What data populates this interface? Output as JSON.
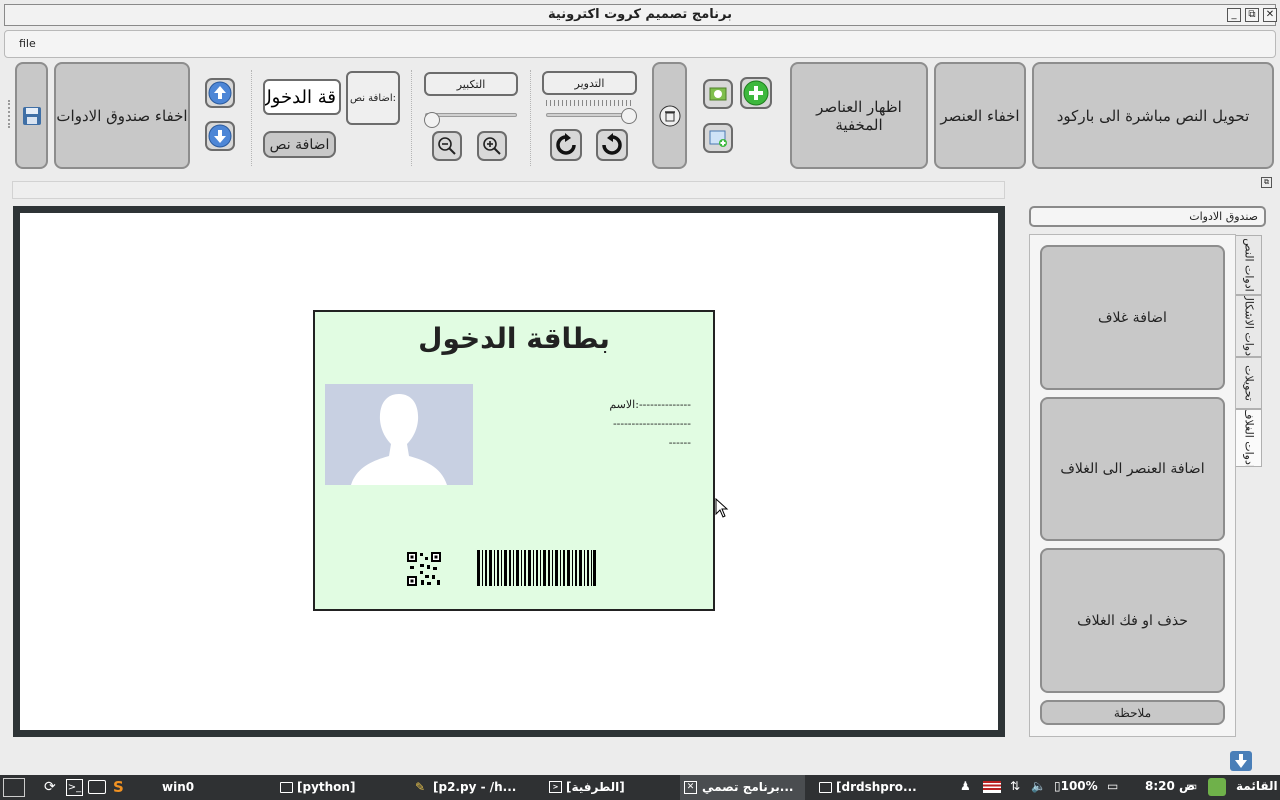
{
  "window": {
    "title": "برنامج تصميم كروت اكترونية",
    "controls": [
      "minimize",
      "maximize",
      "close"
    ]
  },
  "menu": {
    "file_label": "file"
  },
  "toolbar": {
    "hide_toolbox": "اخفاء صندوق الادوات",
    "text_input_value": "قة الدخول",
    "add_text_caption": "اضافة نص:",
    "add_text_button": "اضافة نص",
    "zoom_label": "التكبير",
    "rotate_label": "التدوير",
    "show_hidden": "اظهار العناصر المخفية",
    "hide_element": "اخفاء العنصر",
    "text_to_barcode": "تحويل النص مباشرة الى باركود"
  },
  "card": {
    "title": "بطاقة الدخول",
    "name_label": "الاسم:",
    "line1_dashes": "--------------",
    "line2_dashes": "---------------------",
    "line3_dashes": "------"
  },
  "dock": {
    "title": "صندوق الادوات",
    "add_cover": "اضافة غلاف",
    "add_element_to_cover": "اضافة العنصر الى الغلاف",
    "delete_cover": "حذف او فك الغلاف",
    "notes": "ملاحظة",
    "tabs": [
      "ادوات النص",
      "ادوات الاشكال",
      "تحويلات",
      "ادوات الغلاف"
    ]
  },
  "taskbar": {
    "items": [
      "win0",
      "[python]",
      "[p2.py - /h...",
      "[الطرفية]",
      "برنامج تصمي...",
      "[drdshpro..."
    ],
    "battery": "100%",
    "clock": "8:20 ص",
    "menu_label": "القائمة"
  },
  "colors": {
    "card_bg": "#e1fce2",
    "canvas_border": "#2e3436",
    "button_bg": "#c8c8c8",
    "taskbar_bg": "#2f3133"
  }
}
